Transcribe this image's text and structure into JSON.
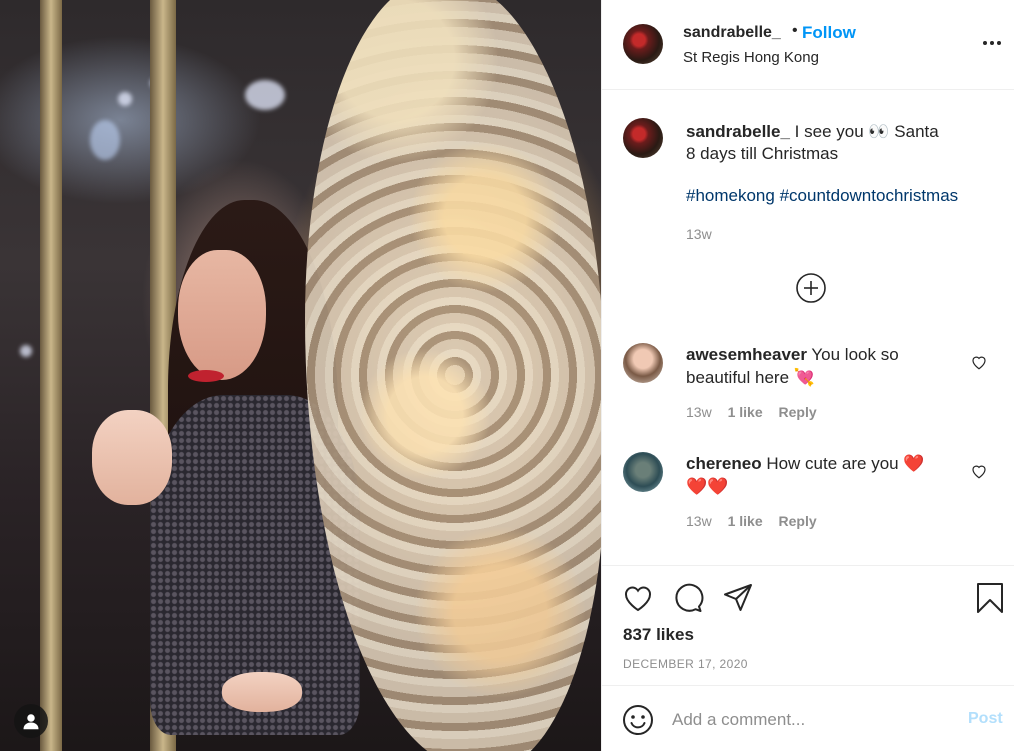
{
  "post": {
    "username": "sandrabelle_",
    "separator": "•",
    "follow_label": "Follow",
    "location": "St Regis Hong Kong",
    "image_alt": "Woman in a sparkly dress smiling beside a lit holiday garland"
  },
  "caption": {
    "username": "sandrabelle_",
    "text_line1": " I see you 👀 Santa",
    "text_line2": "8 days till Christmas",
    "hashtags": [
      "#homekong",
      "#countdowntochristmas"
    ],
    "time": "13w"
  },
  "comments": [
    {
      "username": "awesemheaver",
      "text": " You look so beautiful here 💘",
      "time": "13w",
      "likes": "1 like",
      "reply": "Reply"
    },
    {
      "username": "chereneo",
      "text": " How cute are you ❤️ ❤️❤️",
      "time": "13w",
      "likes": "1 like",
      "reply": "Reply"
    }
  ],
  "engagement": {
    "likes": "837 likes",
    "date": "DECEMBER 17, 2020"
  },
  "add_comment": {
    "placeholder": "Add a comment...",
    "post_label": "Post"
  },
  "colors": {
    "link_blue": "#0095f6",
    "hashtag": "#00376b",
    "post_disabled": "#b2dffc",
    "muted": "#8e8e8e"
  },
  "icons": [
    "more-icon",
    "load-more-icon",
    "heart-icon",
    "comment-icon",
    "share-icon",
    "bookmark-icon",
    "emoji-icon",
    "account-icon"
  ]
}
